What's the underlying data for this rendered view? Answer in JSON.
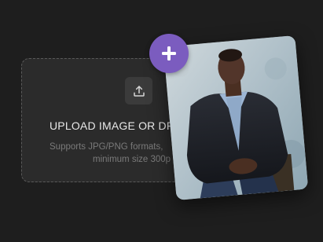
{
  "dropzone": {
    "title": "UPLOAD IMAGE OR DRA",
    "description_line1": "Supports JPG/PNG formats,",
    "description_line2": "minimum size 300p",
    "upload_icon": "upload-icon"
  },
  "add_badge": {
    "icon": "plus-icon",
    "color": "#7b5cbf"
  },
  "preview": {
    "subject": "man in dark jacket seated against light backdrop"
  }
}
